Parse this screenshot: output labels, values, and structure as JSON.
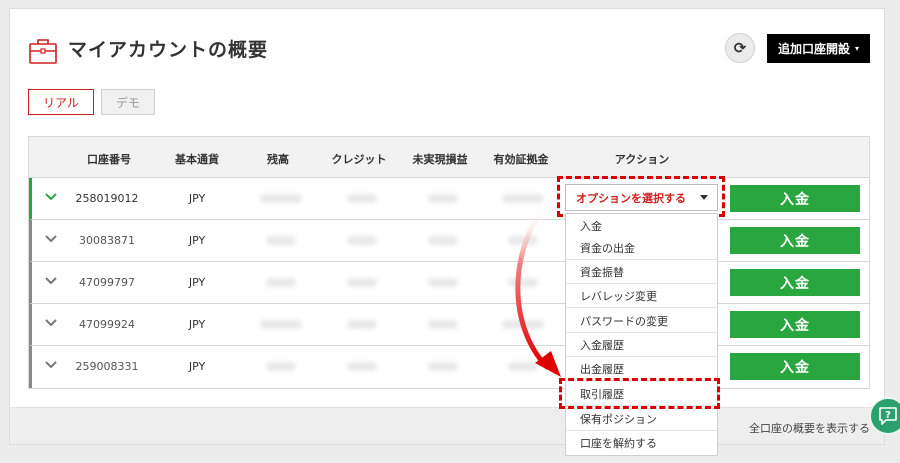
{
  "header": {
    "title": "マイアカウントの概要",
    "refresh_icon": "⟳",
    "add_account_label": "追加口座開設",
    "add_account_caret": "▾"
  },
  "tabs": [
    {
      "label": "リアル",
      "active": true
    },
    {
      "label": "デモ",
      "active": false
    }
  ],
  "table": {
    "columns": [
      "口座番号",
      "基本通貨",
      "残高",
      "クレジット",
      "未実現損益",
      "有効証拠金",
      "アクション"
    ],
    "rows": [
      {
        "account": "258019012",
        "currency": "JPY",
        "expanded": true
      },
      {
        "account": "30083871",
        "currency": "JPY",
        "expanded": false
      },
      {
        "account": "47099797",
        "currency": "JPY",
        "expanded": false
      },
      {
        "account": "47099924",
        "currency": "JPY",
        "expanded": false
      },
      {
        "account": "259008331",
        "currency": "JPY",
        "expanded": false
      }
    ],
    "deposit_label": "入金"
  },
  "action_select": {
    "selected": "オプションを選択する",
    "options": [
      "入金",
      "資金の出金",
      "資金振替",
      "レバレッジ変更",
      "パスワードの変更",
      "入金履歴",
      "出金履歴",
      "取引履歴",
      "保有ポジション",
      "口座を解約する"
    ],
    "highlighted_option": "取引履歴"
  },
  "footer": {
    "show_all_label": "全口座の概要を表示する"
  },
  "colors": {
    "accent_red": "#d12020",
    "deposit_green": "#2aa641",
    "help_green": "#2aa06e"
  },
  "icons": {
    "title": "briefcase-icon",
    "refresh": "refresh-icon",
    "row_toggle": "chevron-down-icon",
    "help": "help-icon"
  }
}
